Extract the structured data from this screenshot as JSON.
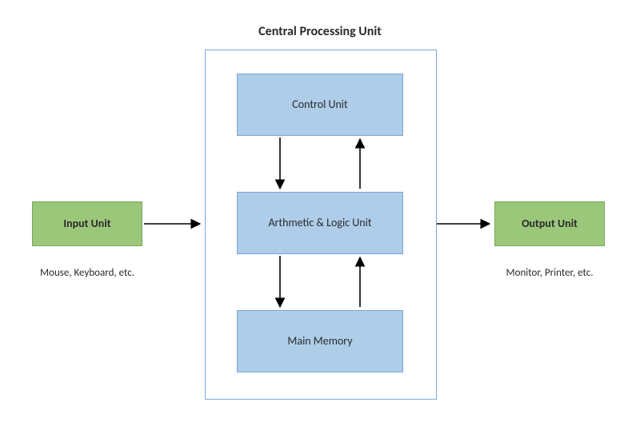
{
  "title": "Central Processing Unit",
  "input": {
    "label": "Input Unit",
    "caption": "Mouse, Keyboard, etc."
  },
  "output": {
    "label": "Output Unit",
    "caption": "Monitor, Printer, etc."
  },
  "cpu": {
    "control": "Control Unit",
    "alu": "Arthmetic & Logic Unit",
    "memory": "Main Memory"
  },
  "colors": {
    "blue": "#aecde9",
    "green": "#9bc77a",
    "frame": "#7aa8d6"
  }
}
